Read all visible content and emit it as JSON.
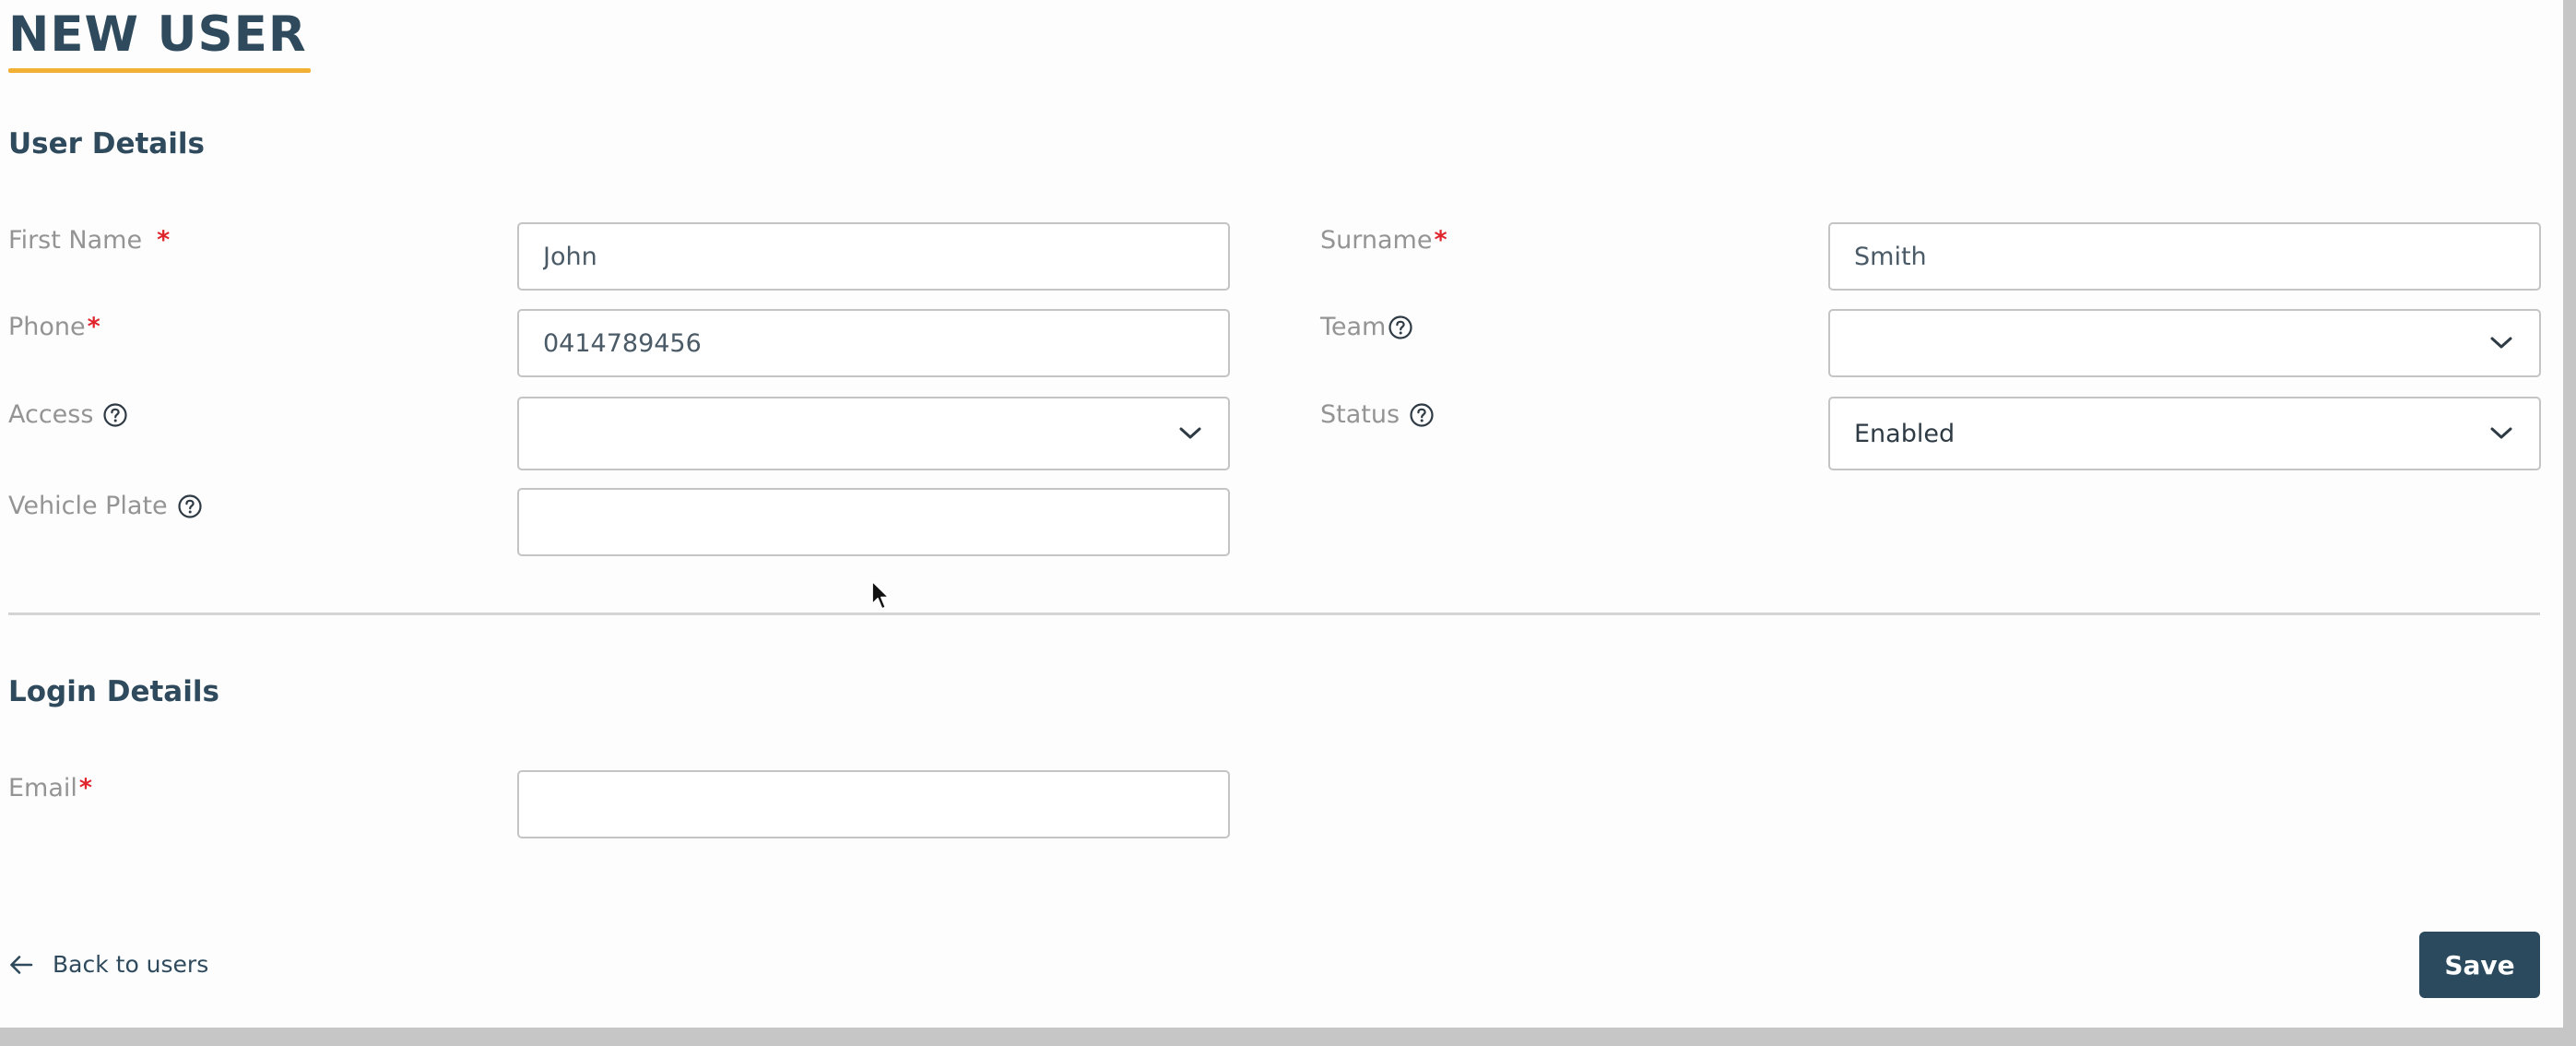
{
  "page": {
    "title": "NEW USER"
  },
  "user_details": {
    "heading": "User Details",
    "required_mark": "*",
    "first_name": {
      "label": "First Name",
      "value": "John"
    },
    "surname": {
      "label": "Surname",
      "value": "Smith"
    },
    "phone": {
      "label": "Phone",
      "value": "0414789456"
    },
    "team": {
      "label": "Team",
      "value": ""
    },
    "access": {
      "label": "Access",
      "value": ""
    },
    "status": {
      "label": "Status",
      "value": "Enabled"
    },
    "vehicle_plate": {
      "label": "Vehicle Plate",
      "value": ""
    }
  },
  "login_details": {
    "heading": "Login Details",
    "email": {
      "label": "Email",
      "value": ""
    }
  },
  "footer": {
    "back_label": "Back to users",
    "save_label": "Save"
  },
  "icons": {
    "help": "question-circle-icon",
    "chevron": "chevron-down-icon",
    "back": "arrow-left-icon",
    "cursor": "mouse-pointer-icon"
  },
  "colors": {
    "primary": "#2b4a5e",
    "accent_underline": "#f2b134",
    "required": "#e0242b",
    "label": "#949494"
  }
}
